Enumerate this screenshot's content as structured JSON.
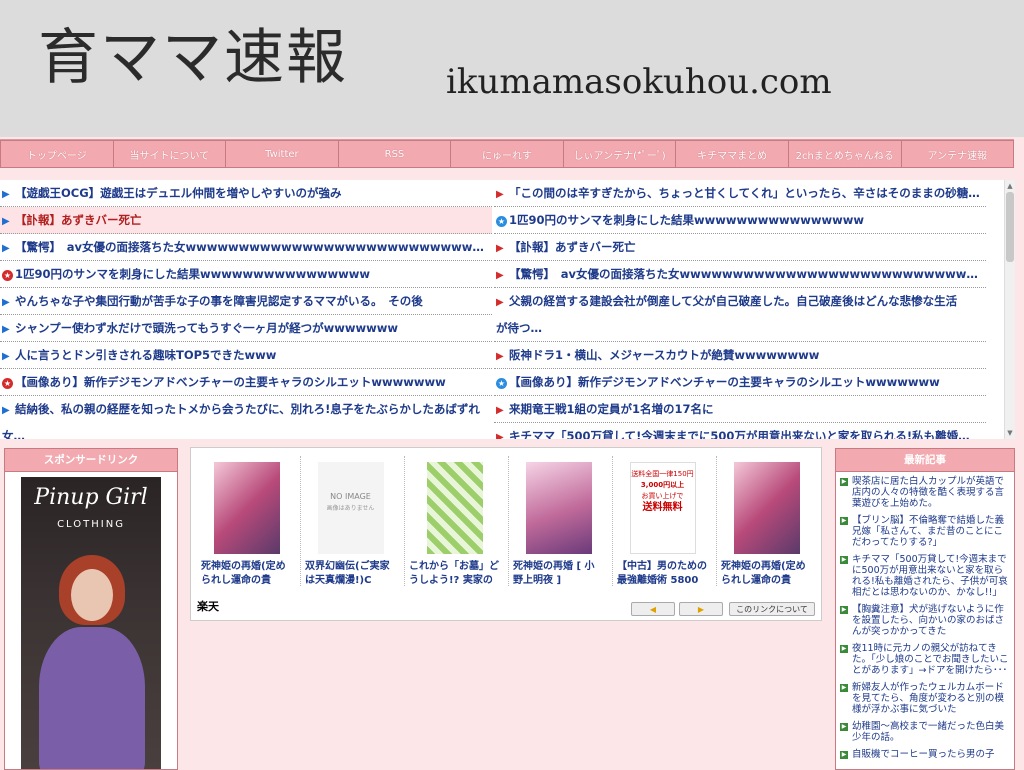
{
  "header": {
    "title": "育ママ速報",
    "domain": "ikumamasokuhou.com"
  },
  "nav": [
    "トップページ",
    "当サイトについて",
    "Twitter",
    "RSS",
    "にゅーれす",
    "しぃアンテナ(*ﾟーﾟ)",
    "キチママまとめ",
    "2chまとめちゃんねる",
    "アンテナ速報"
  ],
  "headlines": {
    "left": [
      "【遊戯王OCG】遊戯王はデュエル仲間を増やしやすいのが強み",
      "【訃報】あずきバー死亡",
      "【驚愕】　av女優の面接落ちた女wwwwwwwwwwwwwwwwwwwwwwwwwwwww…",
      "1匹90円のサンマを刺身にした結果wwwwwwwwwwwwwwww",
      "やんちゃな子や集団行動が苦手な子の事を障害児認定するママがいる。　その後",
      "シャンプー使わず水だけで頭洗ってもうすぐ一ヶ月が経つがwwwwwww",
      "人に言うとドン引きされる趣味TOP5できたwww",
      "【画像あり】新作デジモンアドベンチャーの主要キャラのシルエットwwwwwww",
      "結納後、私の親の経歴を知ったトメから会うたびに、別れろ!息子をたぶらかしたあばずれ",
      "女…"
    ],
    "right": [
      "「この間のは辛すぎたから、ちょっと甘くしてくれ」といったら、辛さはそのままの砂糖…",
      "1匹90円のサンマを刺身にした結果wwwwwwwwwwwwwwww",
      "【訃報】あずきバー死亡",
      "【驚愕】　av女優の面接落ちた女wwwwwwwwwwwwwwwwwwwwwwwwwwwww…",
      "父親の経営する建設会社が倒産して父が自己破産した。自己破産後はどんな悲惨な生活",
      "が待つ…",
      "阪神ドラ1・横山、メジャースカウトが絶賛wwwwwwww",
      "【画像あり】新作デジモンアドベンチャーの主要キャラのシルエットwwwwwww",
      "来期竜王戦1組の定員が1名増の17名に",
      "キチママ「500万貸して!今週末までに500万が用意出来ないと家を取られる!私も離婚…"
    ]
  },
  "sponsor": {
    "heading": "スポンサードリンク",
    "ad_logo": "Pinup Girl",
    "ad_sub": "CLOTHING"
  },
  "rakuten": {
    "items": [
      "死神姫の再婚(定められし運命の貴",
      "双界幻幽伝(ご実家は天真爛漫!)C",
      "これから「お墓」どうしよう!? 実家のお墓",
      "死神姫の再婚 [ 小野上明夜 ]",
      "【中古】男のための最強離婚術 5800",
      "死神姫の再婚(定められし運命の貴"
    ],
    "no_image": "NO IMAGE",
    "no_image_sub": "画像はありません",
    "sale_line1": "送料全国一律150円",
    "sale_line2": "3,000円以上",
    "sale_line3": "お買い上げで",
    "sale_line4": "送料無料",
    "logo": "楽天",
    "prev": "◀",
    "next": "▶",
    "about": "このリンクについて"
  },
  "latest": {
    "heading": "最新記事",
    "items": [
      "喫茶店に居た白人カップルが英語で店内の人々の特徴を酷く表現する言葉遊びを上始めた。",
      "【ブリン脳】不倫略奪で結婚した義兄嫁「私さんて、まだ昔のことにこだわってたりする?」",
      "キチママ「500万貸して!今週末までに500万が用意出来ないと家を取られる!私も離婚されたら、子供が可哀相だとは思わないのか、かなし!!」",
      "【胸糞注意】犬が逃げないように作を設置したら、向かいの家のおばさんが突っかかってきた",
      "夜11時に元カノの親父が訪ねてきた。「少し娘のことでお聞きしたいことがあります」→ドアを開けたら･･･",
      "新婦友人が作ったウェルカムボードを見てたら、角度が変わると別の模様が浮かぶ事に気づいた",
      "幼稚園〜高校まで一緒だった色白美少年の話。",
      "自販機でコーヒー買ったら男の子"
    ]
  },
  "colors": {
    "nav_bg": "#f2a9b0",
    "headline_text": "#1e3a8a",
    "page_bg": "#fde6e8"
  }
}
